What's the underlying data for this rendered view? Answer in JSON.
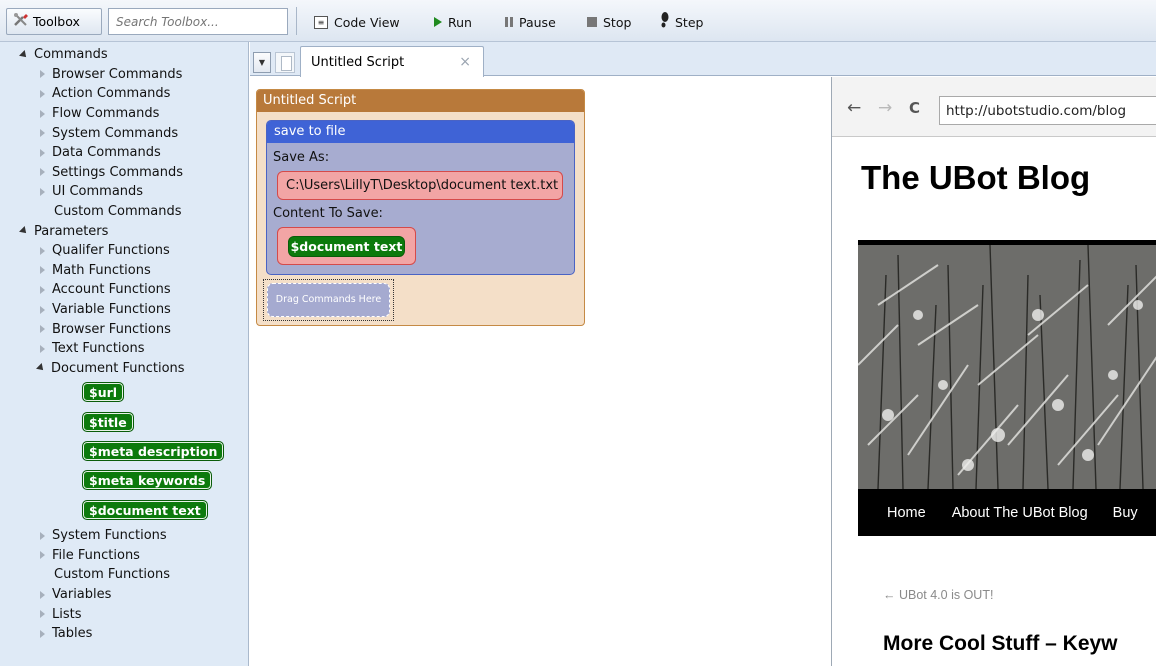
{
  "toolbar": {
    "toolbox_label": "Toolbox",
    "search_placeholder": "Search Toolbox...",
    "code_view_label": "Code View",
    "run_label": "Run",
    "pause_label": "Pause",
    "stop_label": "Stop",
    "step_label": "Step"
  },
  "toolbox": {
    "commands_label": "Commands",
    "commands": [
      "Browser Commands",
      "Action Commands",
      "Flow Commands",
      "System Commands",
      "Data Commands",
      "Settings Commands",
      "UI Commands",
      "Custom Commands"
    ],
    "parameters_label": "Parameters",
    "functions": [
      "Qualifer Functions",
      "Math Functions",
      "Account Functions",
      "Variable Functions",
      "Browser Functions",
      "Text Functions",
      "Document Functions"
    ],
    "document_functions": [
      "$url",
      "$title",
      "$meta description",
      "$meta keywords",
      "$document text"
    ],
    "more": [
      "System Functions",
      "File Functions",
      "Custom Functions",
      "Variables",
      "Lists",
      "Tables"
    ]
  },
  "tabs": {
    "active_label": "Untitled Script",
    "close_glyph": "×",
    "dropdown_glyph": "▼"
  },
  "script": {
    "title": "Untitled Script",
    "command_title": "save to file",
    "save_as_label": "Save As:",
    "save_as_value": "C:\\Users\\LillyT\\Desktop\\document text.txt",
    "content_label": "Content To Save:",
    "content_value": "$document text",
    "drop_hint": "Drag Commands Here"
  },
  "browser": {
    "back_glyph": "←",
    "forward_glyph": "→",
    "refresh_glyph": "C",
    "url": "http://ubotstudio.com/blog",
    "blog_title": "The UBot Blog",
    "menu": [
      "Home",
      "About The UBot Blog",
      "Buy"
    ],
    "prev_post_link": "← UBot 4.0 is OUT!",
    "post_title": "More Cool Stuff – Keyw"
  }
}
